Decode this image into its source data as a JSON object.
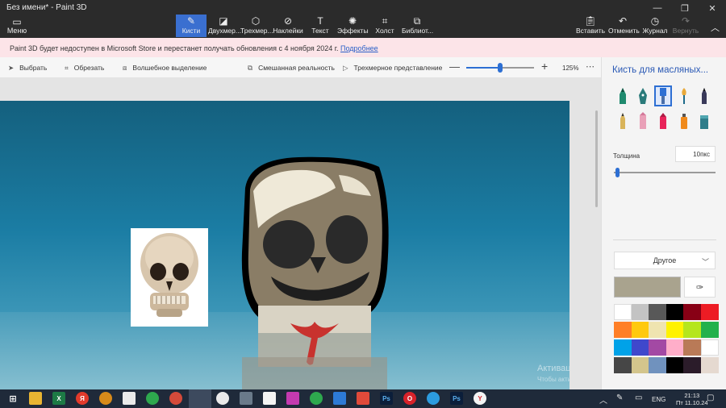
{
  "window": {
    "title": "Без имени* - Paint 3D",
    "controls": [
      "—",
      "❐",
      "✕"
    ]
  },
  "ribbon": {
    "menu": {
      "label": "Меню",
      "icon": "folder-icon"
    },
    "tools": [
      {
        "label": "Кисти",
        "icon": "brush-icon",
        "active": true
      },
      {
        "label": "Двухмер...",
        "icon": "shapes-2d-icon"
      },
      {
        "label": "Трехмер...",
        "icon": "shapes-3d-icon"
      },
      {
        "label": "Наклейки",
        "icon": "sticker-icon"
      },
      {
        "label": "Текст",
        "icon": "text-icon"
      },
      {
        "label": "Эффекты",
        "icon": "effects-icon"
      },
      {
        "label": "Холст",
        "icon": "canvas-icon"
      },
      {
        "label": "Библиот...",
        "icon": "library-icon"
      }
    ],
    "right_tools": [
      {
        "label": "Вставить",
        "icon": "paste-icon"
      },
      {
        "label": "Отменить",
        "icon": "undo-icon"
      },
      {
        "label": "Журнал",
        "icon": "history-icon"
      },
      {
        "label": "Вернуть",
        "icon": "redo-icon",
        "disabled": true
      }
    ]
  },
  "banner": {
    "text": "Paint 3D будет недоступен в Microsoft Store и перестанет получать обновления с 4 ноября 2024 г.",
    "link": "Подробнее"
  },
  "toolbar2": {
    "select": "Выбрать",
    "crop": "Обрезать",
    "magic_select": "Волшебное выделение",
    "mixed_reality": "Смешанная реальность",
    "view_3d": "Трехмерное представление",
    "zoom": {
      "value_label": "125%",
      "fraction": 0.5
    }
  },
  "panel": {
    "title": "Кисть для масляных...",
    "thickness_label": "Толщина",
    "thickness_value": "10пкс",
    "thickness_fraction": 0.02,
    "dropdown_value": "Другое",
    "current_color": "#a9a38e",
    "palette": [
      "#ffffff",
      "#c3c3c3",
      "#585858",
      "#000000",
      "#880015",
      "#ed1c24",
      "#ff7f27",
      "#ffc90e",
      "#efe4b0",
      "#fff200",
      "#b5e61d",
      "#22b14c",
      "#00a2e8",
      "#3f48cc",
      "#a349a4",
      "#ffaec9",
      "#b97a57",
      "#ffffff",
      "#464646",
      "#d3c58c",
      "#7092be",
      "#000000",
      "#2b1c2a",
      "#e5d9d0"
    ]
  },
  "watermark": {
    "line1": "Активация Windows",
    "line2": "Чтобы активировать Windows, перейдите в раздел \"Параметры\"."
  },
  "taskbar": {
    "lang": "ENG",
    "time": "21:13",
    "date": "Пт 11.10.24"
  }
}
